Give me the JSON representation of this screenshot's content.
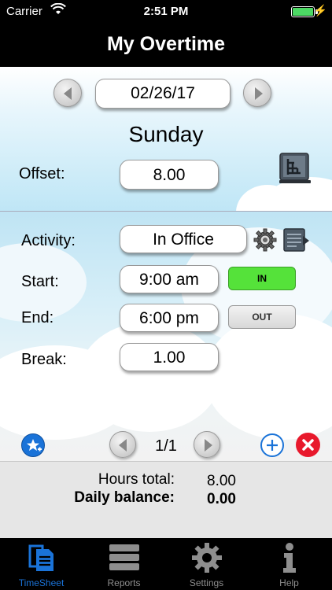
{
  "status": {
    "carrier": "Carrier",
    "time": "2:51 PM",
    "battery_level": 1.0
  },
  "nav": {
    "title": "My Overtime"
  },
  "date": {
    "value": "02/26/17",
    "day": "Sunday"
  },
  "offset": {
    "label": "Offset:",
    "value": "8.00"
  },
  "activity": {
    "label": "Activity:",
    "value": "In Office"
  },
  "start": {
    "label": "Start:",
    "value": "9:00 am",
    "button": "IN"
  },
  "end": {
    "label": "End:",
    "value": "6:00 pm",
    "button": "OUT"
  },
  "break": {
    "label": "Break:",
    "value": "1.00"
  },
  "pager": {
    "value": "1/1"
  },
  "totals": {
    "hours_label": "Hours total:",
    "hours_value": "8.00",
    "balance_label": "Daily balance:",
    "balance_value": "0.00"
  },
  "tabs": [
    {
      "label": "TimeSheet",
      "icon": "timesheet-icon",
      "active": true
    },
    {
      "label": "Reports",
      "icon": "reports-icon",
      "active": false
    },
    {
      "label": "Settings",
      "icon": "settings-gear-icon",
      "active": false
    },
    {
      "label": "Help",
      "icon": "info-icon",
      "active": false
    }
  ],
  "colors": {
    "in_button": "#55e23a",
    "active_tab": "#1a73d8",
    "delete": "#e8192c",
    "add": "#1a73d8"
  }
}
